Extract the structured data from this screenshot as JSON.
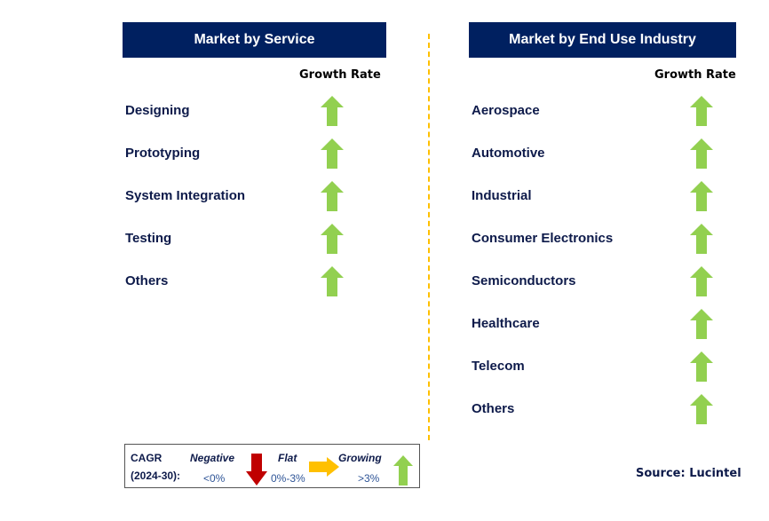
{
  "left_panel": {
    "title": "Market by Service",
    "growth_label": "Growth Rate",
    "items": [
      {
        "label": "Designing",
        "trend": "growing"
      },
      {
        "label": "Prototyping",
        "trend": "growing"
      },
      {
        "label": "System Integration",
        "trend": "growing"
      },
      {
        "label": "Testing",
        "trend": "growing"
      },
      {
        "label": "Others",
        "trend": "growing"
      }
    ]
  },
  "right_panel": {
    "title": "Market by End Use Industry",
    "growth_label": "Growth Rate",
    "items": [
      {
        "label": "Aerospace",
        "trend": "growing"
      },
      {
        "label": "Automotive",
        "trend": "growing"
      },
      {
        "label": "Industrial",
        "trend": "growing"
      },
      {
        "label": "Consumer Electronics",
        "trend": "growing"
      },
      {
        "label": "Semiconductors",
        "trend": "growing"
      },
      {
        "label": "Healthcare",
        "trend": "growing"
      },
      {
        "label": "Telecom",
        "trend": "growing"
      },
      {
        "label": "Others",
        "trend": "growing"
      }
    ]
  },
  "legend": {
    "cagr_label": "CAGR",
    "period": "(2024-30):",
    "negative": {
      "label": "Negative",
      "range": "<0%",
      "icon": "down-arrow-icon",
      "color": "#c00000"
    },
    "flat": {
      "label": "Flat",
      "range": "0%-3%",
      "icon": "right-arrow-icon",
      "color": "#ffc000"
    },
    "growing": {
      "label": "Growing",
      "range": ">3%",
      "icon": "up-arrow-icon",
      "color": "#92d050"
    }
  },
  "source": "Source: Lucintel",
  "colors": {
    "header_bg": "#002060",
    "label_text": "#0d1a4a",
    "divider": "#ffc000"
  }
}
